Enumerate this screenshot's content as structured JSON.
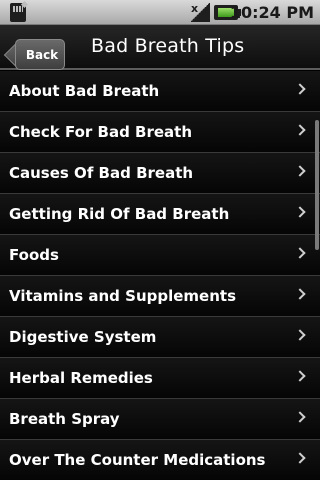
{
  "status_bar": {
    "time": "10:24 PM",
    "icons": [
      "sd-card-icon",
      "no-signal-icon",
      "battery-icon"
    ]
  },
  "title_bar": {
    "back_label": "Back",
    "title": "Bad Breath Tips"
  },
  "list": {
    "items": [
      {
        "label": "About Bad Breath"
      },
      {
        "label": "Check For Bad Breath"
      },
      {
        "label": "Causes Of Bad Breath"
      },
      {
        "label": "Getting Rid Of Bad Breath"
      },
      {
        "label": "Foods"
      },
      {
        "label": "Vitamins and Supplements"
      },
      {
        "label": "Digestive System"
      },
      {
        "label": "Herbal Remedies"
      },
      {
        "label": "Breath Spray"
      },
      {
        "label": "Over The Counter Medications"
      }
    ]
  }
}
